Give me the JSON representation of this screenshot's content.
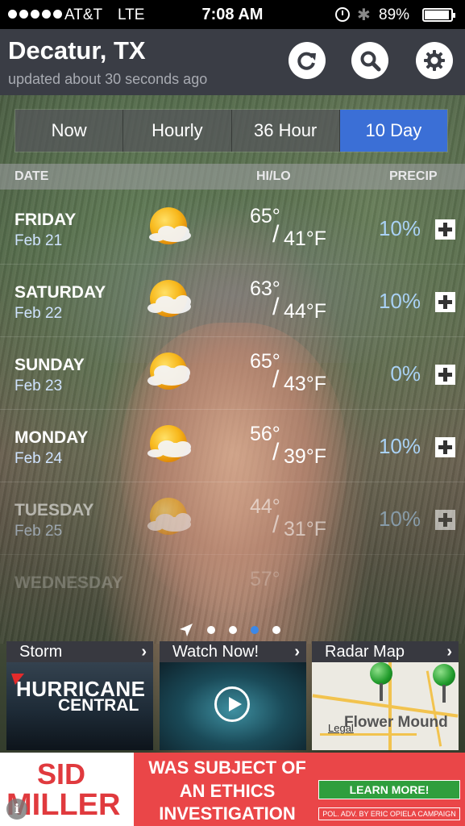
{
  "status_bar": {
    "carrier": "AT&T",
    "network": "LTE",
    "time": "7:08 AM",
    "battery": "89%"
  },
  "header": {
    "city": "Decatur, TX",
    "updated": "updated about 30 seconds ago",
    "buttons": [
      "refresh-icon",
      "search-icon",
      "settings-icon"
    ]
  },
  "tabs": [
    {
      "label": "Now",
      "active": false
    },
    {
      "label": "Hourly",
      "active": false
    },
    {
      "label": "36 Hour",
      "active": false
    },
    {
      "label": "10 Day",
      "active": true
    }
  ],
  "columns": {
    "date": "DATE",
    "hilo": "HI/LO",
    "precip": "PRECIP"
  },
  "forecast": [
    {
      "day": "FRIDAY",
      "date": "Feb 21",
      "hi": "65°",
      "lo": "41°F",
      "precip": "10%",
      "icon": "partly-sunny-icon"
    },
    {
      "day": "SATURDAY",
      "date": "Feb 22",
      "hi": "63°",
      "lo": "44°F",
      "precip": "10%",
      "icon": "partly-sunny-icon"
    },
    {
      "day": "SUNDAY",
      "date": "Feb 23",
      "hi": "65°",
      "lo": "43°F",
      "precip": "0%",
      "icon": "partly-sunny-icon"
    },
    {
      "day": "MONDAY",
      "date": "Feb 24",
      "hi": "56°",
      "lo": "39°F",
      "precip": "10%",
      "icon": "partly-sunny-icon"
    },
    {
      "day": "TUESDAY",
      "date": "Feb 25",
      "hi": "44°",
      "lo": "31°F",
      "precip": "10%",
      "icon": "partly-sunny-icon"
    },
    {
      "day": "WEDNESDAY",
      "hi": "57°"
    }
  ],
  "pager": {
    "pages": 4,
    "active_index": 2
  },
  "tiles": {
    "storm": {
      "title": "Storm",
      "line1": "HURRICANE",
      "line2": "CENTRAL"
    },
    "watch": {
      "title": "Watch Now!"
    },
    "radar": {
      "title": "Radar Map",
      "place": "Flower Mound",
      "legal": "Legal"
    }
  },
  "ad": {
    "name1": "SID",
    "name2": "MILLER",
    "line1": "WAS SUBJECT OF",
    "line2": "AN ETHICS",
    "line3": "INVESTIGATION",
    "cta": "LEARN MORE!",
    "disclaimer": "POL. ADV. BY ERIC OPIELA CAMPAIGN"
  },
  "colors": {
    "header_bg": "#3a3d45",
    "active_tab": "#3b6fd6",
    "precip_text": "#a9d1f5",
    "ad_red": "#ea4648",
    "ad_green": "#2f9e3d"
  }
}
